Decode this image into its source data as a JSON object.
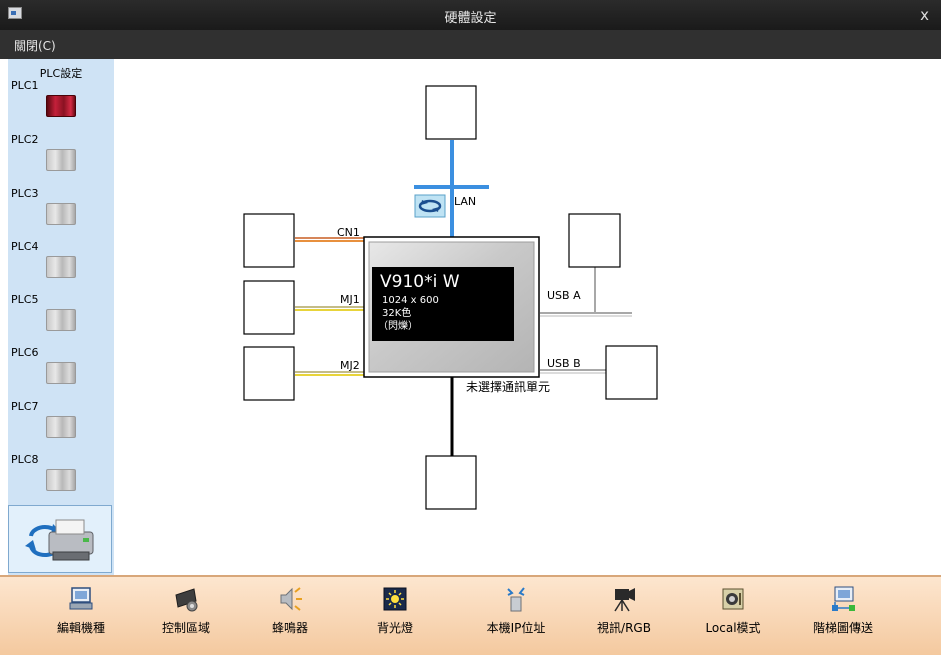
{
  "window": {
    "title": "硬體設定",
    "close_glyph": "x"
  },
  "menu": {
    "close_label": "關閉(C)"
  },
  "plc_panel": {
    "header": "PLC設定",
    "items": [
      {
        "label": "PLC1",
        "icon": "plc-red-icon"
      },
      {
        "label": "PLC2",
        "icon": "plc-gray-icon"
      },
      {
        "label": "PLC3",
        "icon": "plc-gray-icon"
      },
      {
        "label": "PLC4",
        "icon": "plc-gray-icon"
      },
      {
        "label": "PLC5",
        "icon": "plc-gray-icon"
      },
      {
        "label": "PLC6",
        "icon": "plc-gray-icon"
      },
      {
        "label": "PLC7",
        "icon": "plc-gray-icon"
      },
      {
        "label": "PLC8",
        "icon": "plc-gray-icon"
      }
    ]
  },
  "diagram": {
    "device_model": "V910*i W",
    "resolution": "1024 x 600",
    "colors": "32K色",
    "blink": "（閃爍）",
    "ports": {
      "lan": "LAN",
      "cn1": "CN1",
      "mj1": "MJ1",
      "mj2": "MJ2",
      "usb_a": "USB A",
      "usb_b": "USB B"
    },
    "no_comm_unit": "未選擇通訊單元"
  },
  "toolbar": {
    "items": [
      {
        "label": "編輯機種",
        "icon": "edit-model-icon"
      },
      {
        "label": "控制區域",
        "icon": "control-area-icon"
      },
      {
        "label": "蜂鳴器",
        "icon": "buzzer-icon"
      },
      {
        "label": "背光燈",
        "icon": "backlight-icon"
      },
      {
        "label": "本機IP位址",
        "icon": "local-ip-icon"
      },
      {
        "label": "視訊/RGB",
        "icon": "video-rgb-icon"
      },
      {
        "label": "Local模式",
        "icon": "local-mode-icon"
      },
      {
        "label": "階梯圖傳送",
        "icon": "ladder-transfer-icon"
      }
    ]
  },
  "colors": {
    "lan_line": "#3b8fe0",
    "cn1_line": "#e07a3a",
    "mj_line": "#e8d43a",
    "usb_line": "#a8a8a8",
    "screen_bg": "#000000",
    "bottom_bar": "#f9d8b8"
  }
}
